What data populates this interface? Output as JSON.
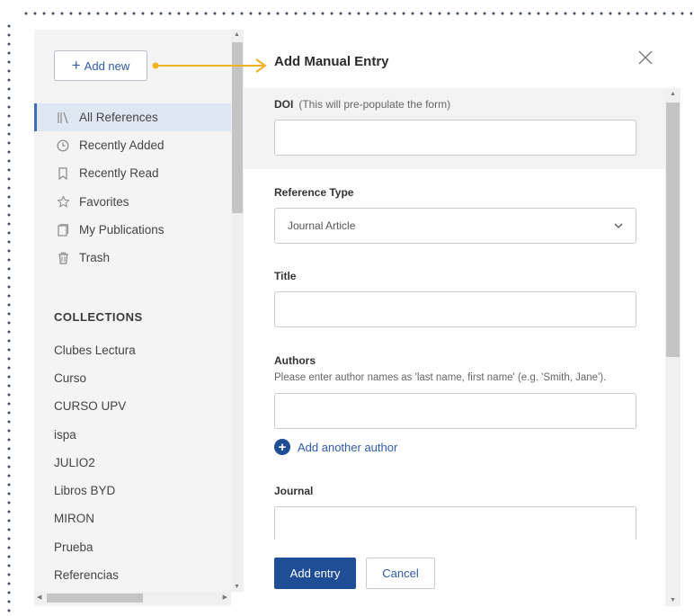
{
  "sidebar": {
    "add_new_label": "Add new",
    "nav_items": [
      {
        "label": "All References",
        "icon": "library-icon",
        "active": true
      },
      {
        "label": "Recently Added",
        "icon": "clock-icon"
      },
      {
        "label": "Recently Read",
        "icon": "bookmark-icon"
      },
      {
        "label": "Favorites",
        "icon": "star-icon"
      },
      {
        "label": "My Publications",
        "icon": "publications-icon"
      },
      {
        "label": "Trash",
        "icon": "trash-icon"
      }
    ],
    "collections_header": "COLLECTIONS",
    "collections": [
      "Clubes Lectura",
      "Curso",
      "CURSO UPV",
      "ispa",
      "JULIO2",
      "Libros BYD",
      "MIRON",
      "Prueba",
      "Referencias"
    ]
  },
  "dialog": {
    "title": "Add Manual Entry",
    "doi": {
      "label": "DOI",
      "hint": "(This will pre-populate the form)",
      "value": ""
    },
    "reference_type": {
      "label": "Reference Type",
      "selected": "Journal Article"
    },
    "title_field": {
      "label": "Title",
      "value": ""
    },
    "authors": {
      "label": "Authors",
      "help": "Please enter author names as 'last name, first name' (e.g. 'Smith, Jane').",
      "value": "",
      "add_another_label": "Add another author"
    },
    "journal": {
      "label": "Journal",
      "value": ""
    },
    "add_entry_label": "Add entry",
    "cancel_label": "Cancel"
  },
  "colors": {
    "accent": "#1f4e97",
    "link": "#2f5aa8",
    "annotation_arrow": "#f0b323",
    "active_item_bg": "#dfe7f3"
  }
}
